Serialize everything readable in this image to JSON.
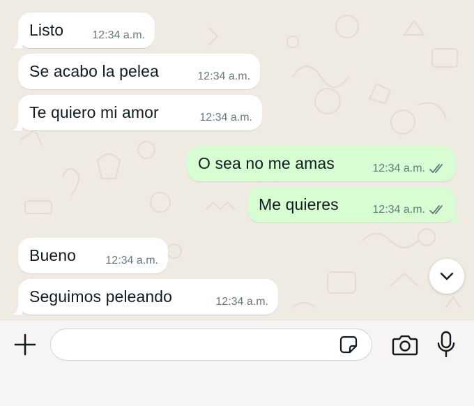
{
  "chat": {
    "messages": [
      {
        "text": "Listo",
        "time": "12:34 a.m.",
        "direction": "incoming"
      },
      {
        "text": "Se acabo la pelea",
        "time": "12:34 a.m.",
        "direction": "incoming"
      },
      {
        "text": "Te quiero mi amor",
        "time": "12:34 a.m.",
        "direction": "incoming"
      },
      {
        "text": "O sea no me amas",
        "time": "12:34 a.m.",
        "direction": "outgoing",
        "status": "read"
      },
      {
        "text": "Me quieres",
        "time": "12:34 a.m.",
        "direction": "outgoing",
        "status": "read"
      },
      {
        "text": "Bueno",
        "time": "12:34 a.m.",
        "direction": "incoming"
      },
      {
        "text": "Seguimos peleando",
        "time": "12:34 a.m.",
        "direction": "incoming"
      }
    ],
    "scroll_down_icon": "chevron-down-icon"
  },
  "composer": {
    "attach_icon": "plus-icon",
    "input_value": "",
    "sticker_icon": "sticker-icon",
    "camera_icon": "camera-icon",
    "mic_icon": "microphone-icon"
  },
  "colors": {
    "incoming_bubble": "#ffffff",
    "outgoing_bubble": "#d9fdd3",
    "chat_background": "#efeae2",
    "timestamp": "#667781",
    "read_ticks": "#667781"
  }
}
